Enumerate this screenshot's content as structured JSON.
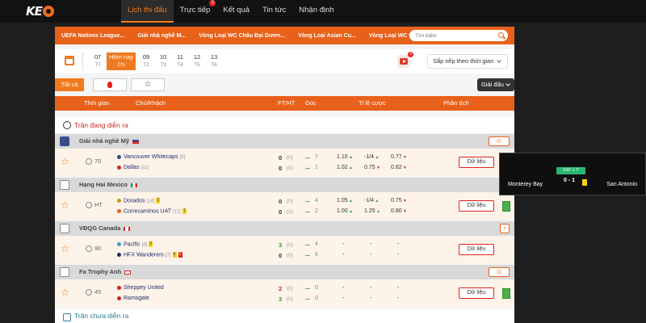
{
  "nav": {
    "logo_text": "KE",
    "items": [
      {
        "label": "Lịch thi đấu"
      },
      {
        "label": "Trực tiếp",
        "badge": "3"
      },
      {
        "label": "Kết quả"
      },
      {
        "label": "Tin tức"
      },
      {
        "label": "Nhận định"
      }
    ]
  },
  "league_tabs": [
    "UEFA Nations League...",
    "Giải nhà nghề M...",
    "Vòng Loại WC Châu Đại Dươn...",
    "Vòng Loại Asian Cu...",
    "Vòng Loại WC Châu ..."
  ],
  "search": {
    "placeholder": "Tìm kiếm"
  },
  "dates": [
    {
      "day": "07",
      "dow": "T7"
    },
    {
      "day": "Hôm nay",
      "dow": "CN"
    },
    {
      "day": "09",
      "dow": "T2"
    },
    {
      "day": "10",
      "dow": "T3"
    },
    {
      "day": "11",
      "dow": "T4"
    },
    {
      "day": "12",
      "dow": "T5"
    },
    {
      "day": "13",
      "dow": "T6"
    }
  ],
  "live_count": "3",
  "sort_label": "Sắp xếp theo thời gian",
  "filters": {
    "all": "Tất cả",
    "league_select": "Giải đấu"
  },
  "table_head": {
    "time": "Thời gian",
    "teams": "Chủ/Khách",
    "ftht": "FT/HT",
    "corner": "Góc",
    "odds": "Tỉ lệ cược",
    "analysis": "Phân tích"
  },
  "sections": {
    "live": "Trận đang diễn ra",
    "upcoming": "Trận chưa diễn ra"
  },
  "leagues": [
    {
      "name": "Giải nhà nghề Mỹ",
      "stats": "¦¦¦¦",
      "match": {
        "time": "70",
        "home": {
          "name": "Vancouver Whitecaps",
          "rank": "[5]"
        },
        "away": {
          "name": "Dallas",
          "rank": "[11]"
        },
        "home_score": "0",
        "away_score": "0",
        "home_ht": "(0)",
        "away_ht": "(0)",
        "home_corner": "7",
        "away_corner": "1",
        "odds_home": [
          "1.10",
          "-1/4",
          "0.77"
        ],
        "odds_away": [
          "1.02",
          "0.75",
          "0.82"
        ],
        "data_label": "Dữ liệu"
      }
    },
    {
      "name": "Hạng Hai Mexico",
      "match": {
        "time": "HT",
        "home": {
          "name": "Dorados",
          "rank": "[14]",
          "ycard": "2"
        },
        "away": {
          "name": "Correcaminos UAT",
          "rank": "[12]",
          "ycard": "1"
        },
        "home_score": "0",
        "away_score": "0",
        "home_ht": "(0)",
        "away_ht": "(1)",
        "home_corner": "4",
        "away_corner": "2",
        "odds_home": [
          "1.05",
          "-1/4",
          "0.75"
        ],
        "odds_away": [
          "1.00",
          "1.25",
          "0.80"
        ],
        "data_label": "Dữ liệu"
      }
    },
    {
      "name": "VĐQG Canada",
      "stats": "¦¦¦¦",
      "match": {
        "time": "90",
        "home": {
          "name": "Pacific",
          "rank": "[8]",
          "ycard": "2"
        },
        "away": {
          "name": "HFX Wanderers",
          "rank": "[7]",
          "ycard": "6",
          "rcard": "2"
        },
        "home_score": "3",
        "away_score": "0",
        "home_ht": "(0)",
        "away_ht": "(0)",
        "home_corner": "4",
        "away_corner": "6",
        "odds_home": [
          "-",
          "-",
          "-"
        ],
        "odds_away": [
          "-",
          "-",
          "-"
        ],
        "data_label": "Dữ liệu"
      }
    },
    {
      "name": "Fa Trophy Anh",
      "stats": "¦¦¦¦",
      "match": {
        "time": "45",
        "home": {
          "name": "Sheppey United",
          "rank": ""
        },
        "away": {
          "name": "Ramsgate",
          "rank": ""
        },
        "home_score": "2",
        "away_score": "3",
        "home_ht": "(0)",
        "away_ht": "(0)",
        "home_corner": "0",
        "away_corner": "0",
        "odds_home": [
          "-",
          "-",
          "-"
        ],
        "odds_away": [
          "-",
          "-",
          "-"
        ],
        "data_label": "Dữ liệu"
      }
    }
  ],
  "widget": {
    "minute": "100' + 7'",
    "home": "Monterey Bay",
    "score": "0 - 1",
    "away": "San Antonio"
  },
  "colors": {
    "accent": "#e8611a",
    "nav_bg": "#121212",
    "live_red": "#c8261f"
  }
}
